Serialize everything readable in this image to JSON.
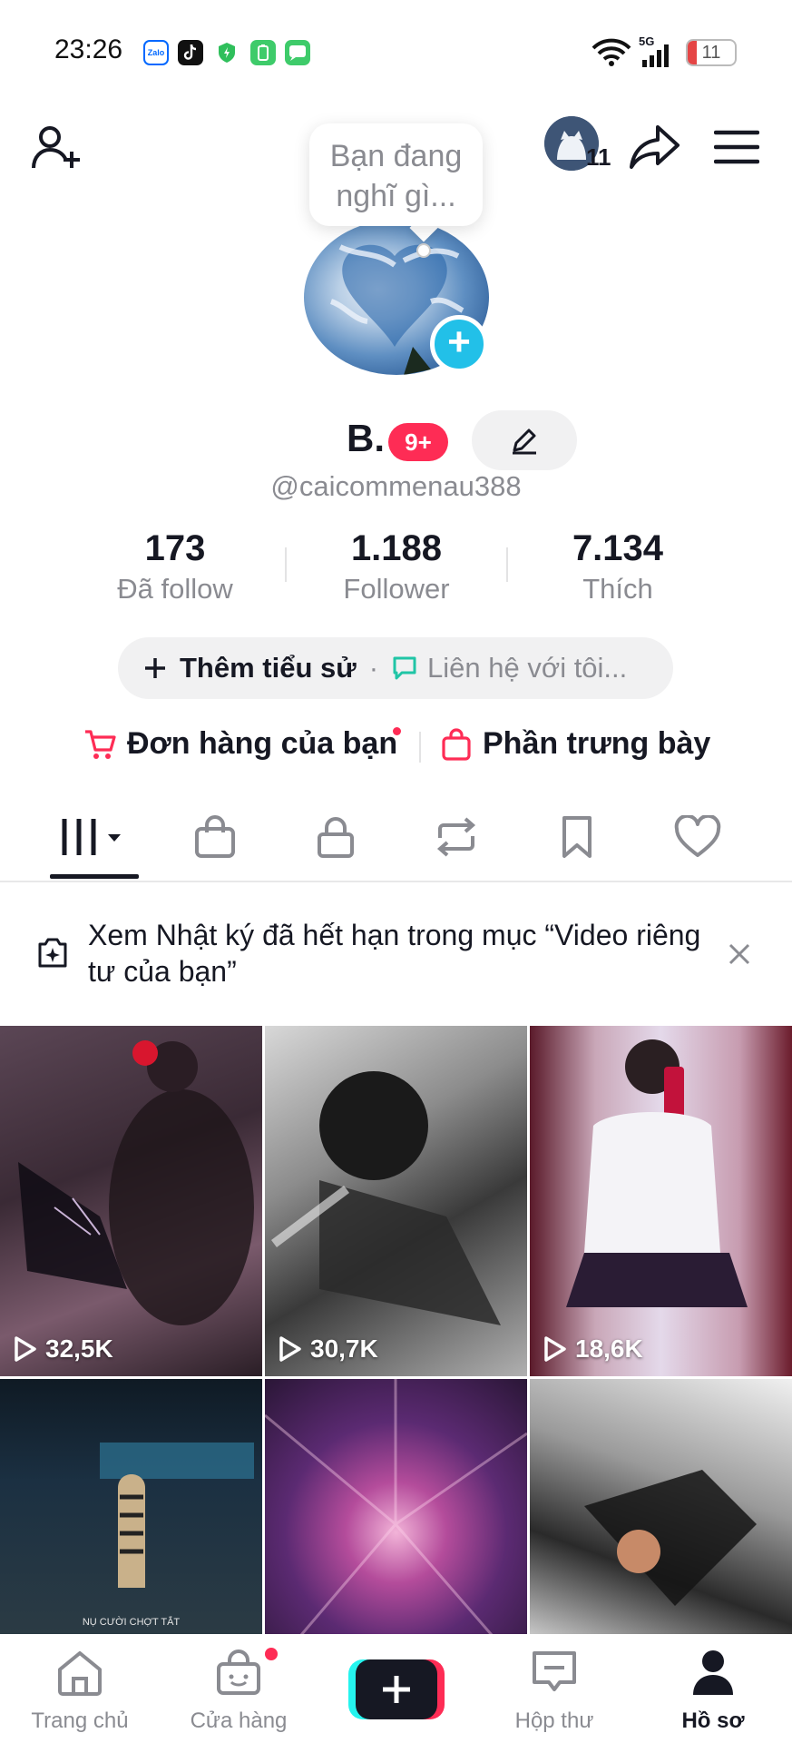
{
  "status_bar": {
    "time": "23:26",
    "apps": [
      "zalo-icon",
      "tiktok-icon",
      "shield-icon",
      "battery-saver-icon",
      "messages-icon"
    ],
    "network": "5G",
    "battery": "11"
  },
  "header": {
    "avatar_count": "11"
  },
  "profile": {
    "bubble_text_line1": "Bạn đang",
    "bubble_text_line2": "nghĩ gì...",
    "name": "B.",
    "badge": "9+",
    "username": "@caicommenau388"
  },
  "stats": [
    {
      "value": "173",
      "label": "Đã follow"
    },
    {
      "value": "1.188",
      "label": "Follower"
    },
    {
      "value": "7.134",
      "label": "Thích"
    }
  ],
  "bio": {
    "add_bio": "Thêm tiểu sử",
    "separator": "·",
    "contact": "Liên hệ với tôi..."
  },
  "shop_links": {
    "orders": "Đơn hàng của bạn",
    "showcase": "Phần trưng bày"
  },
  "notice": {
    "text": "Xem Nhật ký đã hết hạn trong mục “Video riêng tư của bạn”"
  },
  "videos": [
    {
      "views": "32,5K"
    },
    {
      "views": "30,7K"
    },
    {
      "views": "18,6K"
    },
    {
      "views": "",
      "caption": "NỤ CƯỜI CHỢT TẮT"
    },
    {
      "views": ""
    },
    {
      "views": ""
    }
  ],
  "bottom_nav": {
    "home": "Trang chủ",
    "shop": "Cửa hàng",
    "inbox": "Hộp thư",
    "profile": "Hồ sơ"
  },
  "colors": {
    "accent": "#fe2c55",
    "cyan": "#25f4ee",
    "add_button": "#22c0e8",
    "text_secondary": "#8a8b91"
  }
}
